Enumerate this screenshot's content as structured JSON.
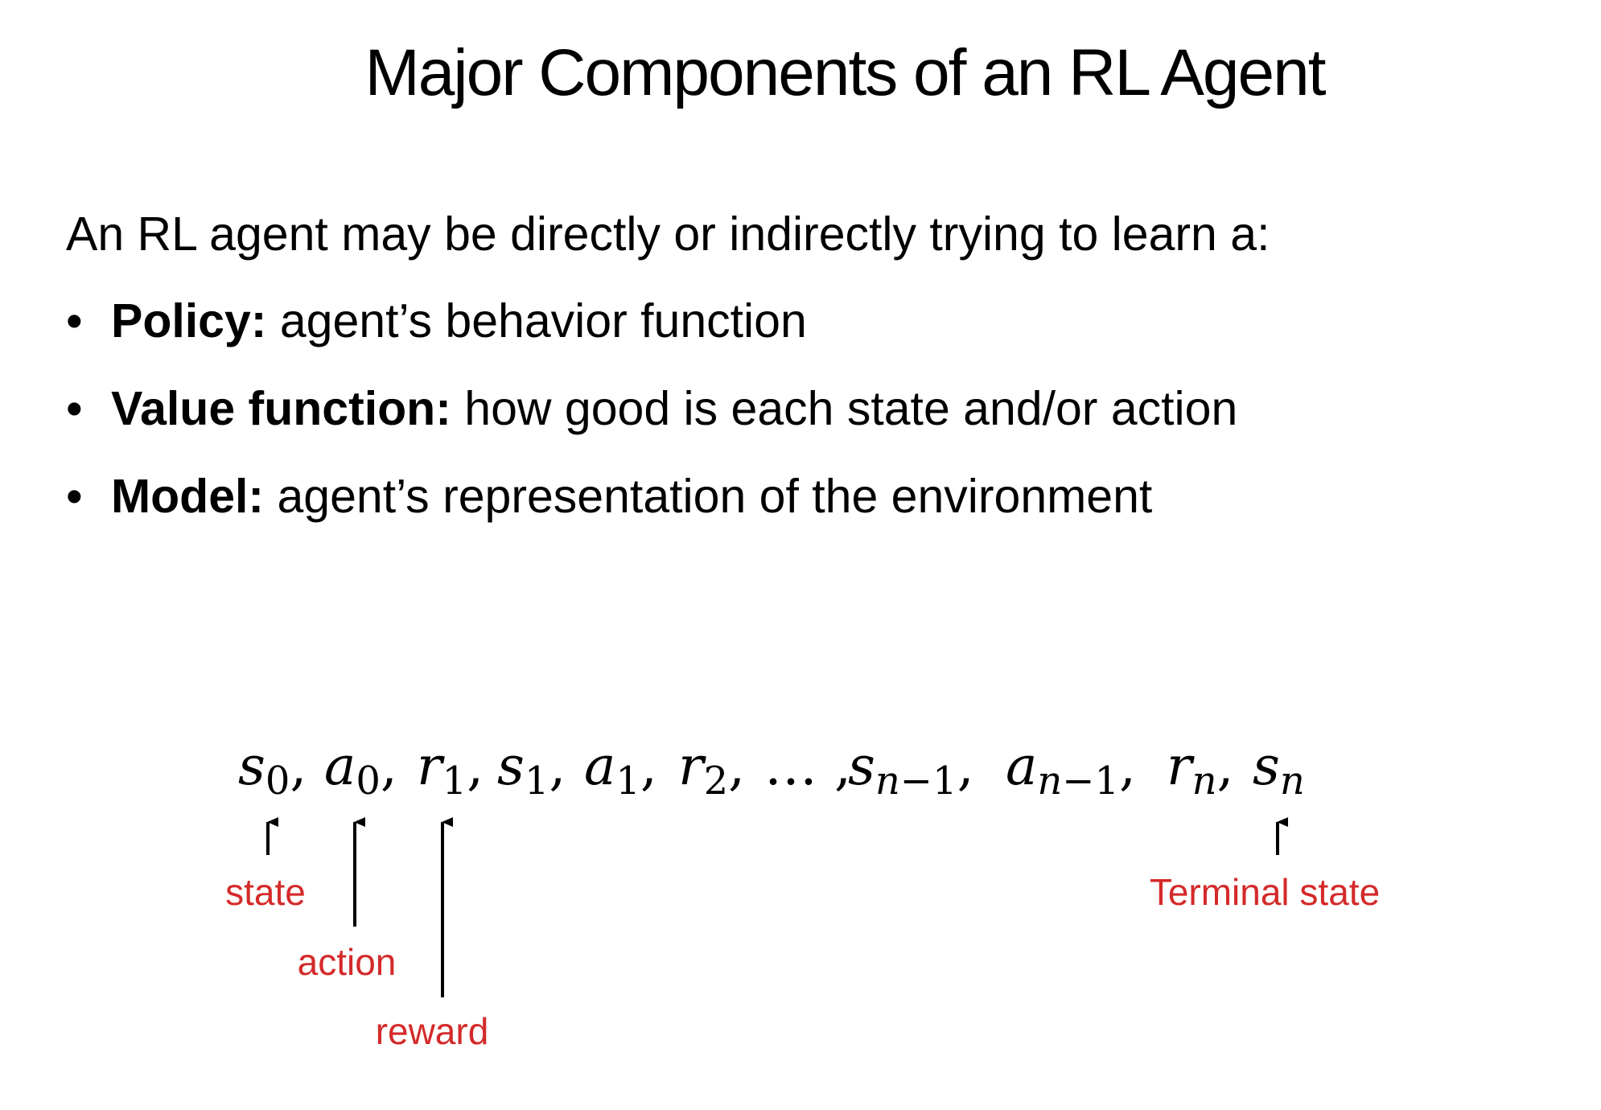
{
  "slide": {
    "title": "Major Components of an RL Agent",
    "intro": "An RL agent may be directly or indirectly trying to learn a:",
    "bullets": [
      {
        "term": "Policy:",
        "description": " agent’s behavior function"
      },
      {
        "term": "Value function:",
        "description": " how good is each state and/or action"
      },
      {
        "term": "Model:",
        "description": " agent’s representation of the  environment"
      }
    ]
  },
  "trajectory": {
    "sequence": [
      "s0",
      "a0",
      "r1",
      "s1",
      "a1",
      "r2",
      "…",
      "sn−1",
      "an−1",
      "rn",
      "sn"
    ],
    "ellipsis": "…",
    "labels": {
      "state": "state",
      "action": "action",
      "reward": "reward",
      "terminal": "Terminal state"
    },
    "label_color": "#d42a2a"
  }
}
